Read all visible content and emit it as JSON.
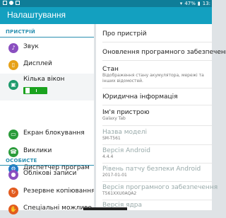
{
  "statusbar": {
    "battery": "47%",
    "time": "13:"
  },
  "appbar": {
    "title": "Налаштування"
  },
  "left": {
    "sections": [
      {
        "header": "ПРИСТРІЙ",
        "items": [
          {
            "label": "Звук",
            "icon": "sound-icon",
            "color": "#8a4fc0"
          },
          {
            "label": "Дисплей",
            "icon": "display-icon",
            "color": "#e6a119"
          },
          {
            "label": "Кілька вікон",
            "icon": "multiwindow-icon",
            "color": "#1e9a6c",
            "toggle": "on"
          },
          {
            "label": "Екран блокування",
            "icon": "lockscreen-icon",
            "color": "#2a9b3a"
          },
          {
            "label": "Виклики",
            "icon": "calls-icon",
            "color": "#2a9b3a"
          },
          {
            "label": "Диспетчер програм",
            "icon": "apps-icon",
            "color": "#1f7ac8"
          }
        ]
      },
      {
        "header": "ОСОБИСТЕ",
        "items": [
          {
            "label": "Облікові записи",
            "icon": "accounts-icon",
            "color": "#8a4fc0"
          },
          {
            "label": "Резервне копіювання",
            "icon": "backup-icon",
            "color": "#e25b1f"
          },
          {
            "label": "Спеціальні можливо",
            "icon": "accessibility-icon",
            "color": "#e25b1f"
          }
        ]
      }
    ]
  },
  "right": {
    "rows": [
      {
        "title": "Про пристрій"
      },
      {
        "title": "Оновлення програмного забезпечення"
      },
      {
        "title": "Стан",
        "sub": "Відображення стану акумулятора, мережі та інших відомостей."
      },
      {
        "title": "Юридична інформація"
      },
      {
        "title": "Ім'я пристрою",
        "sub": "Galaxy Tab"
      },
      {
        "title": "Назва моделі",
        "sub": "SM-T561",
        "dim": true
      },
      {
        "title": "Версія Android",
        "sub": "4.4.4",
        "dim": true
      },
      {
        "title": "Рівень патчу безпеки Android",
        "sub": "2017-01-01",
        "dim": true
      },
      {
        "title": "Версія програмного забезпечення",
        "sub": "T561XXU0AQA2",
        "dim": true
      },
      {
        "title": "Версія ядра",
        "dim": true
      }
    ]
  }
}
